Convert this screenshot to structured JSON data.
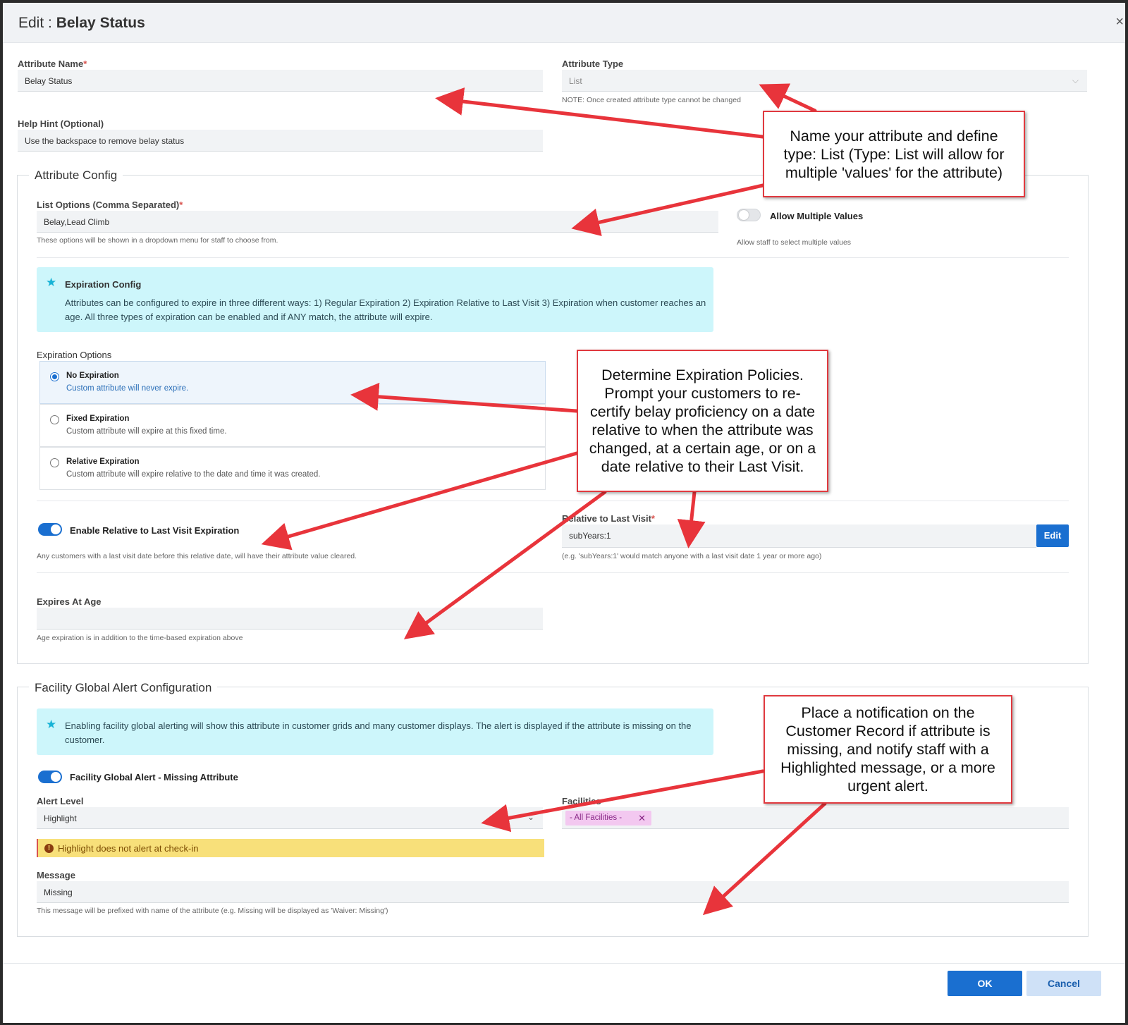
{
  "dialog": {
    "title_prefix": "Edit : ",
    "title_name": "Belay Status",
    "close_glyph": "×"
  },
  "attribute_name": {
    "label": "Attribute Name",
    "required": "*",
    "value": "Belay Status"
  },
  "attribute_type": {
    "label": "Attribute Type",
    "value": "List",
    "note": "NOTE: Once created attribute type cannot be changed"
  },
  "help_hint": {
    "label": "Help Hint (Optional)",
    "value": "Use the backspace to remove belay status"
  },
  "attribute_config": {
    "legend": "Attribute Config",
    "list_options": {
      "label": "List Options (Comma Separated)",
      "required": "*",
      "value": "Belay,Lead Climb",
      "hint": "These options will be shown in a dropdown menu for staff to choose from."
    },
    "allow_multiple": {
      "label": "Allow Multiple Values",
      "hint": "Allow staff to select multiple values",
      "enabled": false
    },
    "expiration_info": {
      "title": "Expiration Config",
      "text": "Attributes can be configured to expire in three different ways: 1) Regular Expiration 2) Expiration Relative to Last Visit 3) Expiration when customer reaches an age. All three types of expiration can be enabled and if ANY match, the attribute will expire."
    },
    "expiration_options": {
      "label": "Expiration Options",
      "options": [
        {
          "title": "No Expiration",
          "desc": "Custom attribute will never expire.",
          "selected": true
        },
        {
          "title": "Fixed Expiration",
          "desc": "Custom attribute will expire at this fixed time.",
          "selected": false
        },
        {
          "title": "Relative Expiration",
          "desc": "Custom attribute will expire relative to the date and time it was created.",
          "selected": false
        }
      ]
    },
    "last_visit_toggle": {
      "label": "Enable Relative to Last Visit Expiration",
      "hint": "Any customers with a last visit date before this relative date, will have their attribute value cleared.",
      "enabled": true
    },
    "relative_last_visit": {
      "label": "Relative to Last Visit",
      "required": "*",
      "value": "subYears:1",
      "button": "Edit",
      "hint": "(e.g. 'subYears:1' would match anyone with a last visit date 1 year or more ago)"
    },
    "expires_at_age": {
      "label": "Expires At Age",
      "value": "",
      "hint": "Age expiration is in addition to the time-based expiration above"
    }
  },
  "facility_alert": {
    "legend": "Facility Global Alert Configuration",
    "info_text": "Enabling facility global alerting will show this attribute in customer grids and many customer displays. The alert is displayed if the attribute is missing on the customer.",
    "toggle": {
      "label": "Facility Global Alert - Missing Attribute",
      "enabled": true
    },
    "alert_level": {
      "label": "Alert Level",
      "value": "Highlight"
    },
    "facilities": {
      "label": "Facilities",
      "chip": "- All Facilities -",
      "chip_remove": "✕"
    },
    "warning": {
      "icon": "!",
      "text": "Highlight does not alert at check-in"
    },
    "message": {
      "label": "Message",
      "value": "Missing",
      "hint": "This message will be prefixed with name of the attribute (e.g. Missing will be displayed as 'Waiver: Missing')"
    }
  },
  "footer": {
    "ok": "OK",
    "cancel": "Cancel"
  },
  "callouts": {
    "name_type": "Name your attribute and define type: List (Type: List will allow for multiple 'values' for the attribute)",
    "expiration": "Determine Expiration Policies. Prompt your customers to re-certify belay proficiency on a date relative to when the attribute was changed, at a certain age, or on a date relative to their Last Visit.",
    "notification": "Place a notification on the Customer Record if attribute is missing, and notify staff with a Highlighted message, or a more urgent alert."
  },
  "colors": {
    "accent": "#1a6fd0",
    "info_bg": "#cdf6fb",
    "warning_bg": "#f8e07a",
    "callout_border": "#e0393f",
    "chip_bg": "#f3c8f0"
  }
}
